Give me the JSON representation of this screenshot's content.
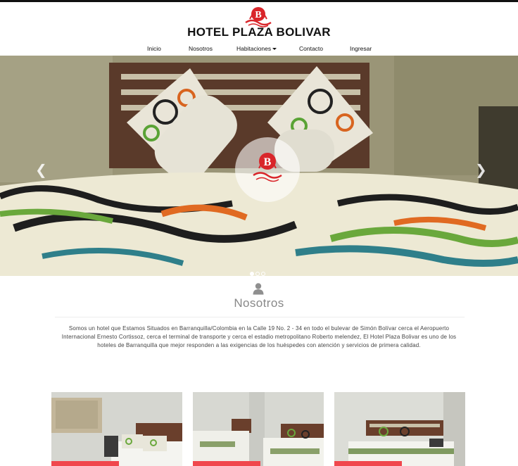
{
  "site": {
    "brand_name": "HOTEL PLAZA BOLIVAR",
    "logo_icon": "hotel-b-logo-icon",
    "accent_color": "#d9252a"
  },
  "nav": {
    "items": [
      {
        "label": "Inicio"
      },
      {
        "label": "Nosotros"
      },
      {
        "label": "Habitaciones",
        "has_dropdown": true
      },
      {
        "label": "Contacto"
      },
      {
        "label": "Ingresar"
      }
    ]
  },
  "carousel": {
    "prev_glyph": "❮",
    "next_glyph": "❯",
    "slide_count": 3,
    "active_slide": 1
  },
  "about": {
    "icon": "person-icon",
    "title": "Nosotros",
    "text": "Somos un hotel que Estamos Situados en Barranquilla/Colombia en la Calle 19 No. 2 - 34 en todo el bulevar de Simón Bolívar cerca el Aeropuerto Internacional Ernesto Cortissoz, cerca el terminal de transporte y cerca el estadio metropolitano Roberto melendez, El Hotel Plaza Bolivar es uno de los hoteles de Barranquilla que mejor responden a las exigencias de los huéspedes con atención y servicios de primera calidad."
  },
  "rooms": {
    "tag_color": "#f0474d",
    "count": 3
  }
}
